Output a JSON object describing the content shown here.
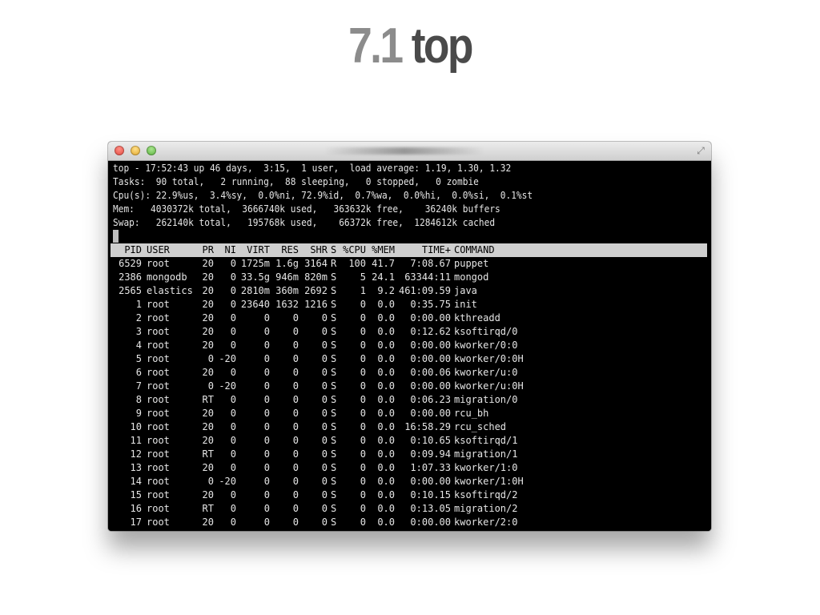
{
  "slide": {
    "title_number": "7.1",
    "title_word": "top"
  },
  "summary": [
    "top - 17:52:43 up 46 days,  3:15,  1 user,  load average: 1.19, 1.30, 1.32",
    "Tasks:  90 total,   2 running,  88 sleeping,   0 stopped,   0 zombie",
    "Cpu(s): 22.9%us,  3.4%sy,  0.0%ni, 72.9%id,  0.7%wa,  0.0%hi,  0.0%si,  0.1%st",
    "Mem:   4030372k total,  3666740k used,   363632k free,    36240k buffers",
    "Swap:   262140k total,   195768k used,    66372k free,  1284612k cached"
  ],
  "columns": [
    "PID",
    "USER",
    "PR",
    "NI",
    "VIRT",
    "RES",
    "SHR",
    "S",
    "%CPU",
    "%MEM",
    "TIME+",
    "COMMAND"
  ],
  "processes": [
    [
      "6529",
      "root",
      "20",
      "0",
      "1725m",
      "1.6g",
      "3164",
      "R",
      "100",
      "41.7",
      "7:08.67",
      "puppet"
    ],
    [
      "2386",
      "mongodb",
      "20",
      "0",
      "33.5g",
      "946m",
      "820m",
      "S",
      "5",
      "24.1",
      "63344:11",
      "mongod"
    ],
    [
      "2565",
      "elastics",
      "20",
      "0",
      "2810m",
      "360m",
      "2692",
      "S",
      "1",
      "9.2",
      "461:09.59",
      "java"
    ],
    [
      "1",
      "root",
      "20",
      "0",
      "23640",
      "1632",
      "1216",
      "S",
      "0",
      "0.0",
      "0:35.75",
      "init"
    ],
    [
      "2",
      "root",
      "20",
      "0",
      "0",
      "0",
      "0",
      "S",
      "0",
      "0.0",
      "0:00.00",
      "kthreadd"
    ],
    [
      "3",
      "root",
      "20",
      "0",
      "0",
      "0",
      "0",
      "S",
      "0",
      "0.0",
      "0:12.62",
      "ksoftirqd/0"
    ],
    [
      "4",
      "root",
      "20",
      "0",
      "0",
      "0",
      "0",
      "S",
      "0",
      "0.0",
      "0:00.00",
      "kworker/0:0"
    ],
    [
      "5",
      "root",
      "0",
      "-20",
      "0",
      "0",
      "0",
      "S",
      "0",
      "0.0",
      "0:00.00",
      "kworker/0:0H"
    ],
    [
      "6",
      "root",
      "20",
      "0",
      "0",
      "0",
      "0",
      "S",
      "0",
      "0.0",
      "0:00.06",
      "kworker/u:0"
    ],
    [
      "7",
      "root",
      "0",
      "-20",
      "0",
      "0",
      "0",
      "S",
      "0",
      "0.0",
      "0:00.00",
      "kworker/u:0H"
    ],
    [
      "8",
      "root",
      "RT",
      "0",
      "0",
      "0",
      "0",
      "S",
      "0",
      "0.0",
      "0:06.23",
      "migration/0"
    ],
    [
      "9",
      "root",
      "20",
      "0",
      "0",
      "0",
      "0",
      "S",
      "0",
      "0.0",
      "0:00.00",
      "rcu_bh"
    ],
    [
      "10",
      "root",
      "20",
      "0",
      "0",
      "0",
      "0",
      "S",
      "0",
      "0.0",
      "16:58.29",
      "rcu_sched"
    ],
    [
      "11",
      "root",
      "20",
      "0",
      "0",
      "0",
      "0",
      "S",
      "0",
      "0.0",
      "0:10.65",
      "ksoftirqd/1"
    ],
    [
      "12",
      "root",
      "RT",
      "0",
      "0",
      "0",
      "0",
      "S",
      "0",
      "0.0",
      "0:09.94",
      "migration/1"
    ],
    [
      "13",
      "root",
      "20",
      "0",
      "0",
      "0",
      "0",
      "S",
      "0",
      "0.0",
      "1:07.33",
      "kworker/1:0"
    ],
    [
      "14",
      "root",
      "0",
      "-20",
      "0",
      "0",
      "0",
      "S",
      "0",
      "0.0",
      "0:00.00",
      "kworker/1:0H"
    ],
    [
      "15",
      "root",
      "20",
      "0",
      "0",
      "0",
      "0",
      "S",
      "0",
      "0.0",
      "0:10.15",
      "ksoftirqd/2"
    ],
    [
      "16",
      "root",
      "RT",
      "0",
      "0",
      "0",
      "0",
      "S",
      "0",
      "0.0",
      "0:13.05",
      "migration/2"
    ],
    [
      "17",
      "root",
      "20",
      "0",
      "0",
      "0",
      "0",
      "S",
      "0",
      "0.0",
      "0:00.00",
      "kworker/2:0"
    ]
  ],
  "icons": {
    "window_controls": [
      "close-icon",
      "minimize-icon",
      "zoom-icon"
    ],
    "fullscreen": "fullscreen-icon"
  },
  "colors": {
    "header_bg": "#cfcfcf",
    "terminal_bg": "#000000",
    "text": "#e6e6e6"
  }
}
